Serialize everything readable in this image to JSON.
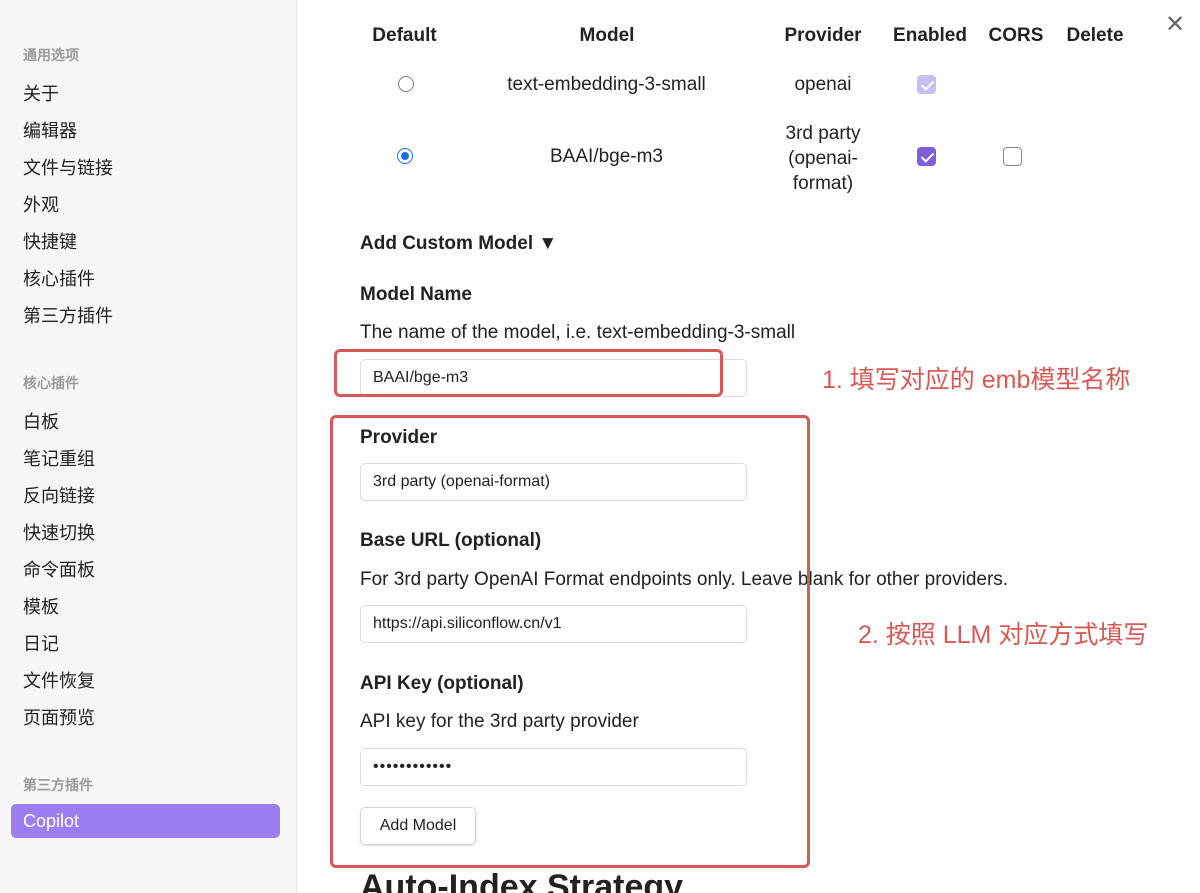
{
  "sidebar": {
    "sections": [
      {
        "title": "通用选项",
        "items": [
          "关于",
          "编辑器",
          "文件与链接",
          "外观",
          "快捷键",
          "核心插件",
          "第三方插件"
        ]
      },
      {
        "title": "核心插件",
        "items": [
          "白板",
          "笔记重组",
          "反向链接",
          "快速切换",
          "命令面板",
          "模板",
          "日记",
          "文件恢复",
          "页面预览"
        ]
      },
      {
        "title": "第三方插件",
        "items": [
          "Copilot"
        ]
      }
    ],
    "active_item": "Copilot"
  },
  "table": {
    "headers": [
      "Default",
      "Model",
      "Provider",
      "Enabled",
      "CORS",
      "Delete"
    ],
    "rows": [
      {
        "default": false,
        "model": "text-embedding-3-small",
        "provider": "openai",
        "enabled": true,
        "enabled_disabled": true,
        "cors": null
      },
      {
        "default": true,
        "model": "BAAI/bge-m3",
        "provider_lines": [
          "3rd party",
          "(openai-",
          "format)"
        ],
        "enabled": true,
        "enabled_disabled": false,
        "cors": false
      }
    ]
  },
  "custom_model": {
    "toggle_label": "Add Custom Model ▼",
    "model_name": {
      "label": "Model Name",
      "description": "The name of the model, i.e. text-embedding-3-small",
      "value": "BAAI/bge-m3"
    },
    "provider": {
      "label": "Provider",
      "value": "3rd party (openai-format)"
    },
    "base_url": {
      "label": "Base URL (optional)",
      "description": "For 3rd party OpenAI Format endpoints only. Leave blank for other providers.",
      "value": "https://api.siliconflow.cn/v1"
    },
    "api_key": {
      "label": "API Key (optional)",
      "description": "API key for the 3rd party provider",
      "value": "••••••••••••"
    },
    "add_button": "Add Model"
  },
  "annotations": {
    "note1": "1. 填写对应的 emb模型名称",
    "note2": "2. 按照 LLM 对应方式填写"
  },
  "next_section_heading": "Auto-Index Strategy",
  "colors": {
    "accent": "#9b7ff0",
    "checkbox_checked": "#7d5fdb",
    "radio": "#1a6ee8",
    "annotation": "#d55a57"
  }
}
